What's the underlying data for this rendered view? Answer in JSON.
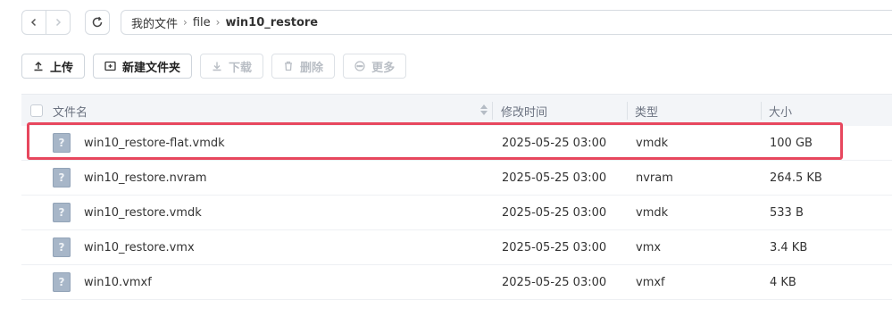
{
  "nav": {
    "back_icon": "chevron-left-icon",
    "forward_icon": "chevron-right-icon",
    "refresh_icon": "refresh-icon"
  },
  "breadcrumb": {
    "items": [
      "我的文件",
      "file",
      "win10_restore"
    ],
    "separator": "›"
  },
  "toolbar": {
    "upload_label": "上传",
    "new_folder_label": "新建文件夹",
    "download_label": "下载",
    "delete_label": "删除",
    "more_label": "更多"
  },
  "table": {
    "columns": [
      "文件名",
      "修改时间",
      "类型",
      "大小"
    ],
    "rows": [
      {
        "name": "win10_restore-flat.vmdk",
        "modified": "2025-05-25 03:00",
        "type": "vmdk",
        "size": "100 GB"
      },
      {
        "name": "win10_restore.nvram",
        "modified": "2025-05-25 03:00",
        "type": "nvram",
        "size": "264.5 KB"
      },
      {
        "name": "win10_restore.vmdk",
        "modified": "2025-05-25 03:00",
        "type": "vmdk",
        "size": "533 B"
      },
      {
        "name": "win10_restore.vmx",
        "modified": "2025-05-25 03:00",
        "type": "vmx",
        "size": "3.4 KB"
      },
      {
        "name": "win10.vmxf",
        "modified": "2025-05-25 03:00",
        "type": "vmxf",
        "size": "4 KB"
      }
    ],
    "file_icon_glyph": "?"
  },
  "colors": {
    "highlight": "#e7475e",
    "header_bg": "#f3f5f8",
    "file_icon": "#a7b6c8"
  }
}
